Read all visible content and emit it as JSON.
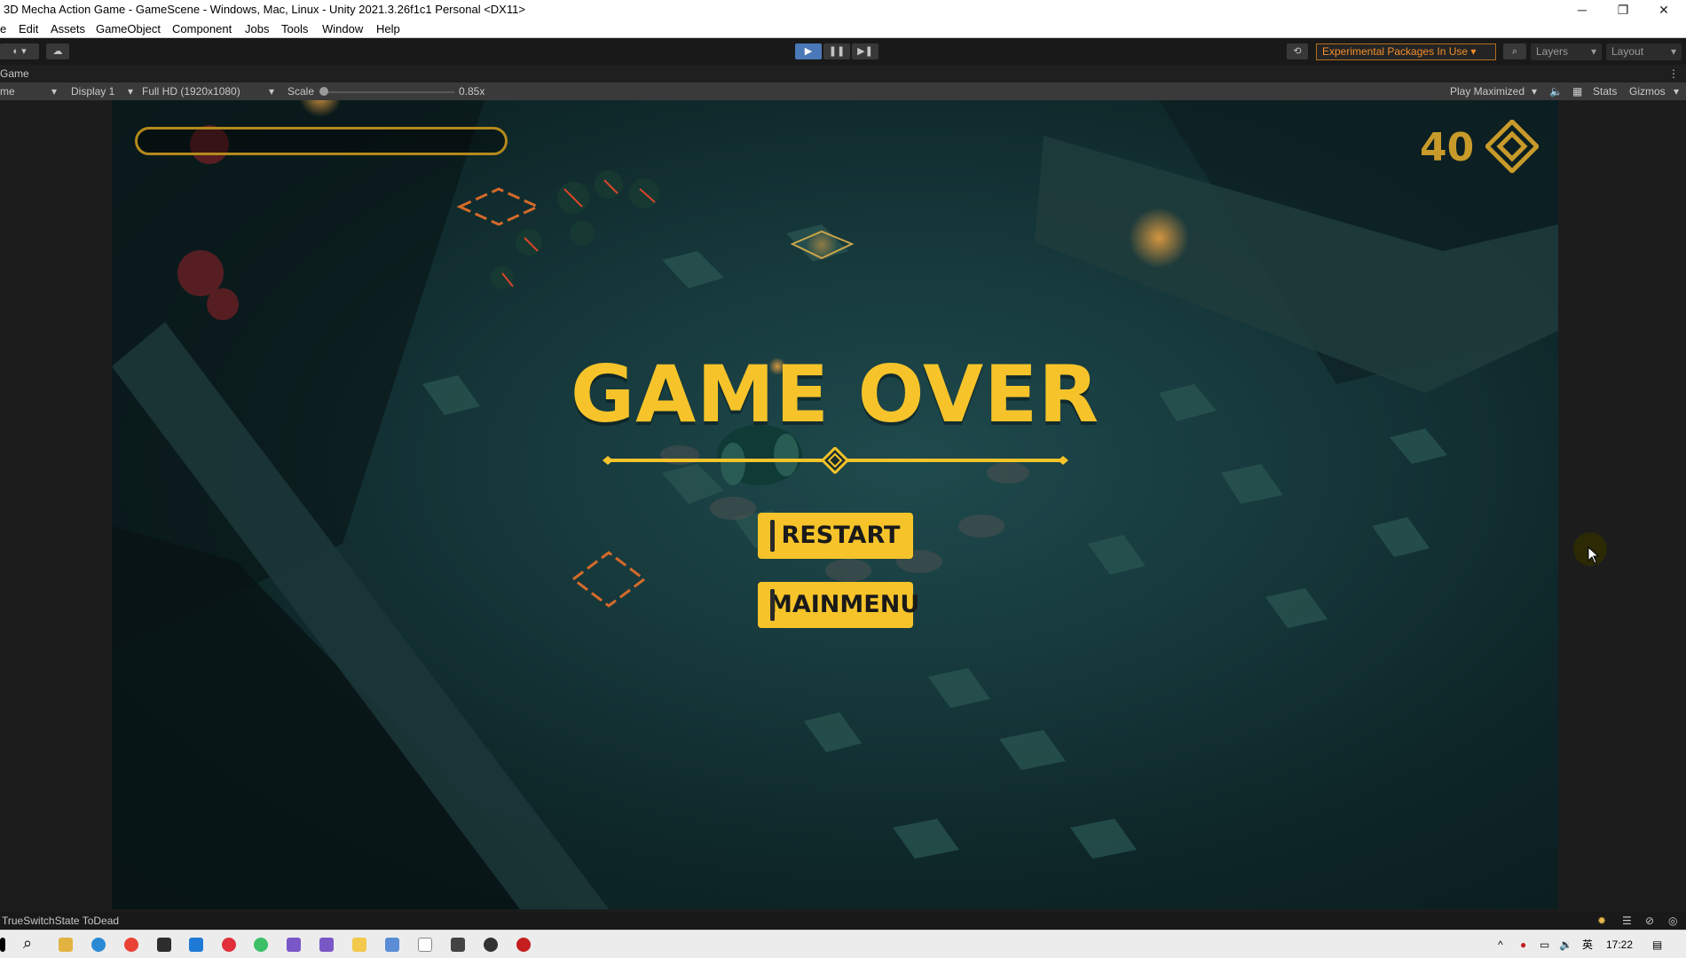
{
  "window": {
    "title": "3D Mecha Action Game - GameScene - Windows, Mac, Linux - Unity 2021.3.26f1c1 Personal <DX11>",
    "controls": [
      "─",
      "❐",
      "✕"
    ]
  },
  "menu": [
    "e",
    "Edit",
    "Assets",
    "GameObject",
    "Component",
    "Jobs",
    "Tools",
    "Window",
    "Help"
  ],
  "toolbar": {
    "experimental_label": "Experimental Packages In Use ▾",
    "layers_label": "Layers",
    "layout_label": "Layout"
  },
  "tab": {
    "label": "Game"
  },
  "game_bar": {
    "mode": "me",
    "display": "Display 1",
    "resolution": "Full HD (1920x1080)",
    "scale_label": "Scale",
    "scale_value": "0.85x",
    "play_mode": "Play Maximized",
    "stats": "Stats",
    "gizmos": "Gizmos"
  },
  "hud": {
    "score": "40",
    "title": "GAME OVER",
    "restart": "RESTART",
    "mainmenu": "MAINMENU"
  },
  "status": {
    "message": "TrueSwitchState ToDead"
  },
  "taskbar": {
    "time": "17:22",
    "ime": "英"
  },
  "colors": {
    "accent_yellow": "#f6c42a",
    "score_gold": "#c79a2a",
    "play_blue": "#4a78b8",
    "warning_orange": "#f28e2b"
  }
}
